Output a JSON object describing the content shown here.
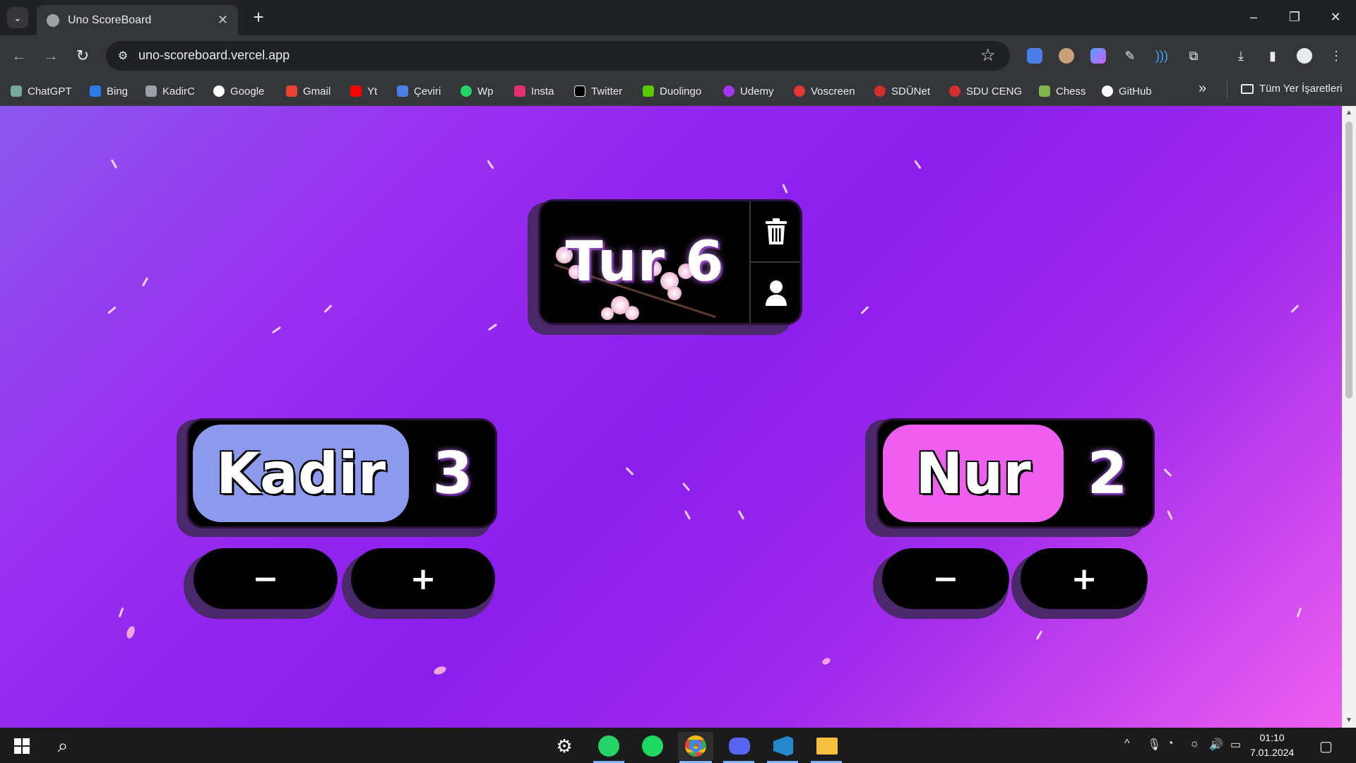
{
  "browser": {
    "tab_title": "Uno ScoreBoard",
    "url": "uno-scoreboard.vercel.app",
    "bookmarks": [
      "ChatGPT",
      "Bing",
      "KadirC",
      "Google",
      "Gmail",
      "Yt",
      "Çeviri",
      "Wp",
      "Insta",
      "Twitter",
      "Duolingo",
      "Udemy",
      "Voscreen",
      "SDÜNet",
      "SDU CENG",
      "Chess",
      "GitHub"
    ],
    "all_bookmarks": "Tüm Yer İşaretleri"
  },
  "game": {
    "round_label": "Tur 6",
    "players": [
      {
        "name": "Kadir",
        "score": "3",
        "color": "#8b9aec",
        "minus": "−",
        "plus": "+"
      },
      {
        "name": "Nur",
        "score": "2",
        "color": "#f05ef0",
        "minus": "−",
        "plus": "+"
      }
    ],
    "icons": {
      "delete": "trash-icon",
      "players": "user-icon"
    }
  },
  "taskbar": {
    "time": "01:10",
    "date": "7.01.2024"
  },
  "colors": {
    "accent_purple": "#9a2ef0",
    "chrome_dark": "#202124",
    "chrome_toolbar": "#35363a"
  }
}
